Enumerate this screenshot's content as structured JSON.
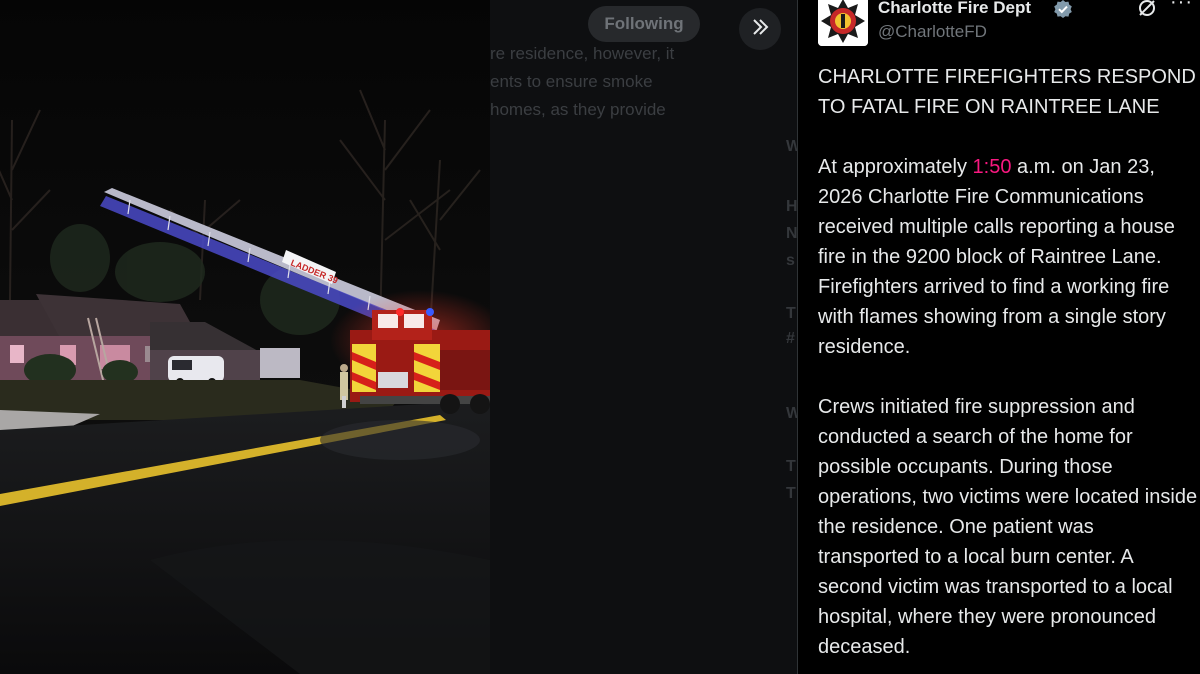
{
  "background_post": {
    "follow_button_label": "Following",
    "text_lines": [
      "re residence, however, it",
      "ents to ensure smoke",
      "homes, as they provide"
    ],
    "letters": [
      "W",
      "H",
      "N",
      "s",
      "T",
      "#",
      "W",
      "T",
      "T"
    ]
  },
  "media_photo": {
    "ladder_text": "LADDER 39"
  },
  "author": {
    "name": "Charlotte Fire Dept",
    "handle": "@CharlotteFD",
    "avatar_icon": "fire-department-badge",
    "verified_icon": "verified-badge-icon",
    "verified_color": "#829aab"
  },
  "actions": {
    "grok_icon": "grok-icon",
    "more_label": "···"
  },
  "post": {
    "headline": "CHARLOTTE FIREFIGHTERS RESPOND TO FATAL FIRE ON RAINTREE LANE",
    "p2_before": "At approximately ",
    "p2_highlight": "1:50",
    "p2_after": " a.m. on Jan 23, 2026 Charlotte Fire Communications received multiple calls reporting a house fire in the 9200 block of Raintree Lane. Firefighters arrived to find a working fire with flames showing from a single story residence.",
    "p3": "Crews initiated fire suppression and conducted a search of the home for possible occupants. During those operations, two victims were located inside the residence. One patient was transported to a local burn center. A second victim was transported to a local hospital, where they were pronounced deceased.",
    "highlight_color": "#f91880"
  }
}
